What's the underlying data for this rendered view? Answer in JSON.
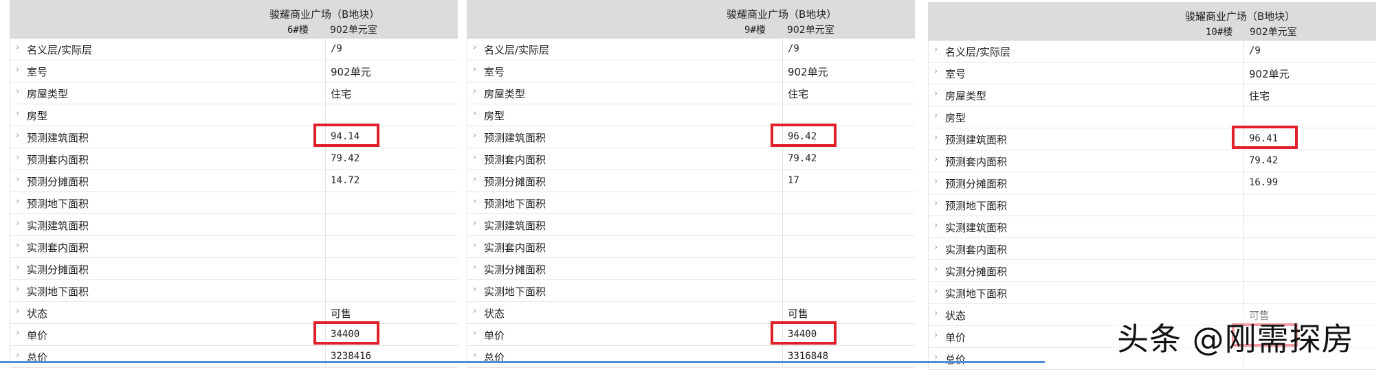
{
  "project_title": "骏耀商业广场（B地块）",
  "labels": [
    "名义层/实际层",
    "室号",
    "房屋类型",
    "房型",
    "预测建筑面积",
    "预测套内面积",
    "预测分摊面积",
    "预测地下面积",
    "实测建筑面积",
    "实测套内面积",
    "实测分摊面积",
    "实测地下面积",
    "状态",
    "单价",
    "总价"
  ],
  "panels": [
    {
      "building": "6#楼",
      "room": "902单元室",
      "values": [
        "/9",
        "902单元",
        "住宅",
        "",
        "94.14",
        "79.42",
        "14.72",
        "",
        "",
        "",
        "",
        "",
        "可售",
        "34400",
        "3238416"
      ]
    },
    {
      "building": "9#楼",
      "room": "902单元室",
      "values": [
        "/9",
        "902单元",
        "住宅",
        "",
        "96.42",
        "79.42",
        "17",
        "",
        "",
        "",
        "",
        "",
        "可售",
        "34400",
        "3316848"
      ]
    },
    {
      "building": "10#楼",
      "room": "902单元室",
      "values": [
        "/9",
        "902单元",
        "住宅",
        "",
        "96.41",
        "79.42",
        "16.99",
        "",
        "",
        "",
        "",
        "",
        "可售",
        "",
        ""
      ]
    }
  ],
  "watermark": "头条 @刚需探房",
  "colors": {
    "header_bg": "#dcdcdc",
    "highlight": "#e0202a",
    "bottom_bar": "#4a90d9"
  }
}
